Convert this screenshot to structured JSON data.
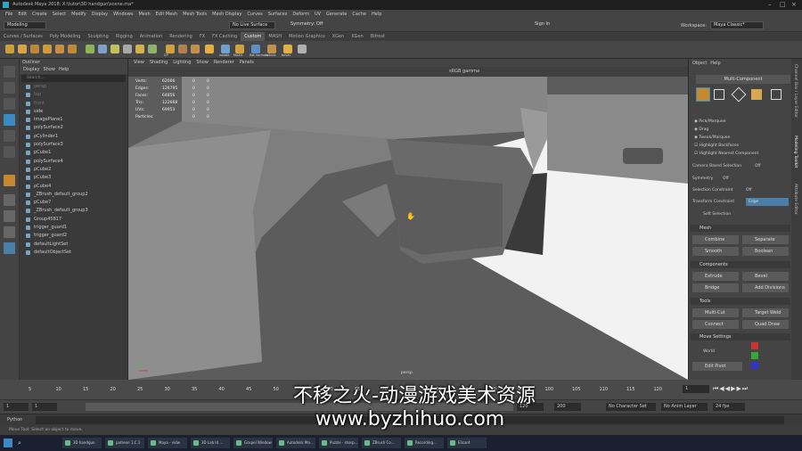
{
  "window": {
    "title": "Autodesk Maya 2018: X:\\tutor\\3D handgun\\scene.ma*"
  },
  "menubar": [
    "File",
    "Edit",
    "Create",
    "Select",
    "Modify",
    "Display",
    "Windows",
    "Mesh",
    "Edit Mesh",
    "Mesh Tools",
    "Mesh Display",
    "Curves",
    "Surfaces",
    "Deform",
    "UV",
    "Generate",
    "Cache",
    "Help"
  ],
  "status": {
    "mode": "Modeling",
    "live_surface": "No Live Surface",
    "symmetry": "Symmetry: Off",
    "signin": "Sign In",
    "workspace_label": "Workspace:",
    "workspace": "Maya Classic*"
  },
  "shelf_tabs": [
    "Curves / Surfaces",
    "Poly Modeling",
    "Sculpting",
    "Rigging",
    "Animation",
    "Rendering",
    "FX",
    "FX Caching",
    "Custom",
    "MASH",
    "Motion Graphics",
    "XGen",
    "XGen",
    "Bifrost"
  ],
  "shelf_tab_active": "Custom",
  "shelf_icon_labels": [
    "CP",
    "isolate",
    "MAXV",
    "flat normals",
    "unlock",
    "bevel"
  ],
  "outliner": {
    "title": "Outliner",
    "menus": [
      "Display",
      "Show",
      "Help"
    ],
    "search": "Search...",
    "items": [
      {
        "label": "persp",
        "dim": true
      },
      {
        "label": "top",
        "dim": true
      },
      {
        "label": "front",
        "dim": true
      },
      {
        "label": "side",
        "dim": false
      },
      {
        "label": "imagePlane1",
        "dim": false
      },
      {
        "label": "polySurface2",
        "dim": false
      },
      {
        "label": "pCylinder1",
        "dim": false
      },
      {
        "label": "polySurface3",
        "dim": false
      },
      {
        "label": "pCube1",
        "dim": false
      },
      {
        "label": "polySurface4",
        "dim": false
      },
      {
        "label": "pCube2",
        "dim": false
      },
      {
        "label": "pCube3",
        "dim": false
      },
      {
        "label": "pCube4",
        "dim": false
      },
      {
        "label": "_ZBrush_default_group2",
        "dim": false
      },
      {
        "label": "pCube7",
        "dim": false
      },
      {
        "label": "_ZBrush_default_group3",
        "dim": false
      },
      {
        "label": "Group45817",
        "dim": false
      },
      {
        "label": "trigger_guard1",
        "dim": false
      },
      {
        "label": "trigger_guard2",
        "dim": false
      },
      {
        "label": "defaultLightSet",
        "dim": false
      },
      {
        "label": "defaultObjectSet",
        "dim": false
      }
    ]
  },
  "viewport": {
    "menus": [
      "View",
      "Shading",
      "Lighting",
      "Show",
      "Renderer",
      "Panels"
    ],
    "color_space": "sRGB gamma",
    "hud": [
      {
        "label": "Verts:",
        "v1": "62006",
        "v2": "0",
        "v3": "0"
      },
      {
        "label": "Edges:",
        "v1": "126795",
        "v2": "0",
        "v3": "0"
      },
      {
        "label": "Faces:",
        "v1": "64856",
        "v2": "0",
        "v3": "0"
      },
      {
        "label": "Tris:",
        "v1": "122668",
        "v2": "0",
        "v3": "0"
      },
      {
        "label": "UVs:",
        "v1": "69953",
        "v2": "0",
        "v3": "0"
      },
      {
        "label": "Particles:",
        "v1": "",
        "v2": "0",
        "v3": "0"
      }
    ],
    "camera": "persp"
  },
  "modeling_toolkit": {
    "menus": [
      "Object",
      "Help"
    ],
    "multi_component": "Multi-Component",
    "options": [
      "Pick/Marquee",
      "Drag",
      "Tweak/Marquee",
      "Highlight Backfaces",
      "Highlight Nearest Component"
    ],
    "camera_based": "Camera Based Selection",
    "camera_based_val": "Off",
    "symmetry": "Symmetry",
    "symmetry_val": "Off",
    "sel_constraint": "Selection Constraint",
    "sel_constraint_val": "Off",
    "transform_constraint": "Transform Constraint",
    "transform_constraint_val": "Edge",
    "soft_selection": "Soft Selection",
    "sections": [
      "Mesh",
      "Components",
      "Tools",
      "Move Settings"
    ],
    "mesh_buttons": [
      "Combine",
      "Separate",
      "Smooth",
      "Boolean"
    ],
    "component_buttons": [
      "Extrude",
      "Bevel",
      "Bridge",
      "Add Divisions"
    ],
    "tool_buttons": [
      "Multi-Cut",
      "Target Weld",
      "Connect",
      "Quad Draw"
    ],
    "move_space": "World",
    "edit_pivot": "Edit Pivot"
  },
  "side_tabs": [
    "Channel Box / Layer Editor",
    "Modeling Toolkit",
    "Attribute Editor"
  ],
  "timeline": {
    "start": "1",
    "end": "120",
    "current": "1",
    "range_start": "1",
    "range_end": "120",
    "range_end2": "200",
    "ticks": [
      "5",
      "10",
      "15",
      "20",
      "25",
      "30",
      "35",
      "40",
      "45",
      "50",
      "55",
      "60",
      "65",
      "70",
      "75",
      "80",
      "85",
      "90",
      "95",
      "100",
      "105",
      "110",
      "115",
      "120"
    ],
    "character_set": "No Character Set",
    "anim_layer": "No Anim Layer",
    "fps": "24 fps"
  },
  "cmdline": {
    "lang": "Python"
  },
  "helpline": "Move Tool: Select an object to move.",
  "taskbar": [
    "3D handgun",
    "patreon 1.C.1",
    "Maya - vidw",
    "3D Lab ld ...",
    "Gospel Window",
    "Autodesk Ma...",
    "Puzzle · sharp...",
    "ZBrush Co...",
    "Recording...",
    "Elicant"
  ],
  "watermark": {
    "line1": "不移之火-动漫游戏美术资源",
    "line2": "www.byzhihuo.com"
  }
}
